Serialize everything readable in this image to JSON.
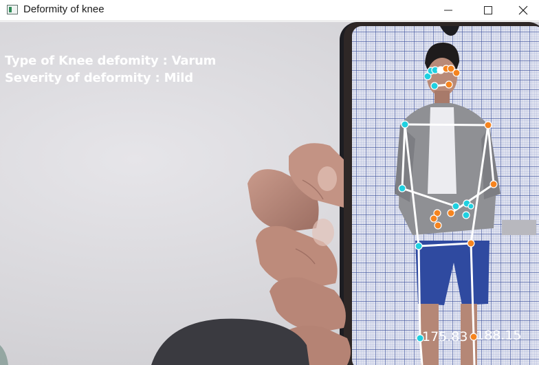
{
  "window": {
    "title": "Deformity of knee",
    "controls": [
      "minimize",
      "maximize",
      "close"
    ],
    "icons": {
      "app": "opencv-window-icon",
      "minimize": "minimize-icon",
      "maximize": "maximize-icon",
      "close": "close-icon"
    }
  },
  "overlay": {
    "line1": "Type of Knee defomity : Varum",
    "line2": "Severity of deformity : Mild"
  },
  "pose": {
    "left_knee_angle": "175.83",
    "right_knee_angle": "188.15",
    "colors": {
      "left": "#1fd0e0",
      "right": "#f5841f",
      "skeleton": "#ffffff"
    }
  }
}
